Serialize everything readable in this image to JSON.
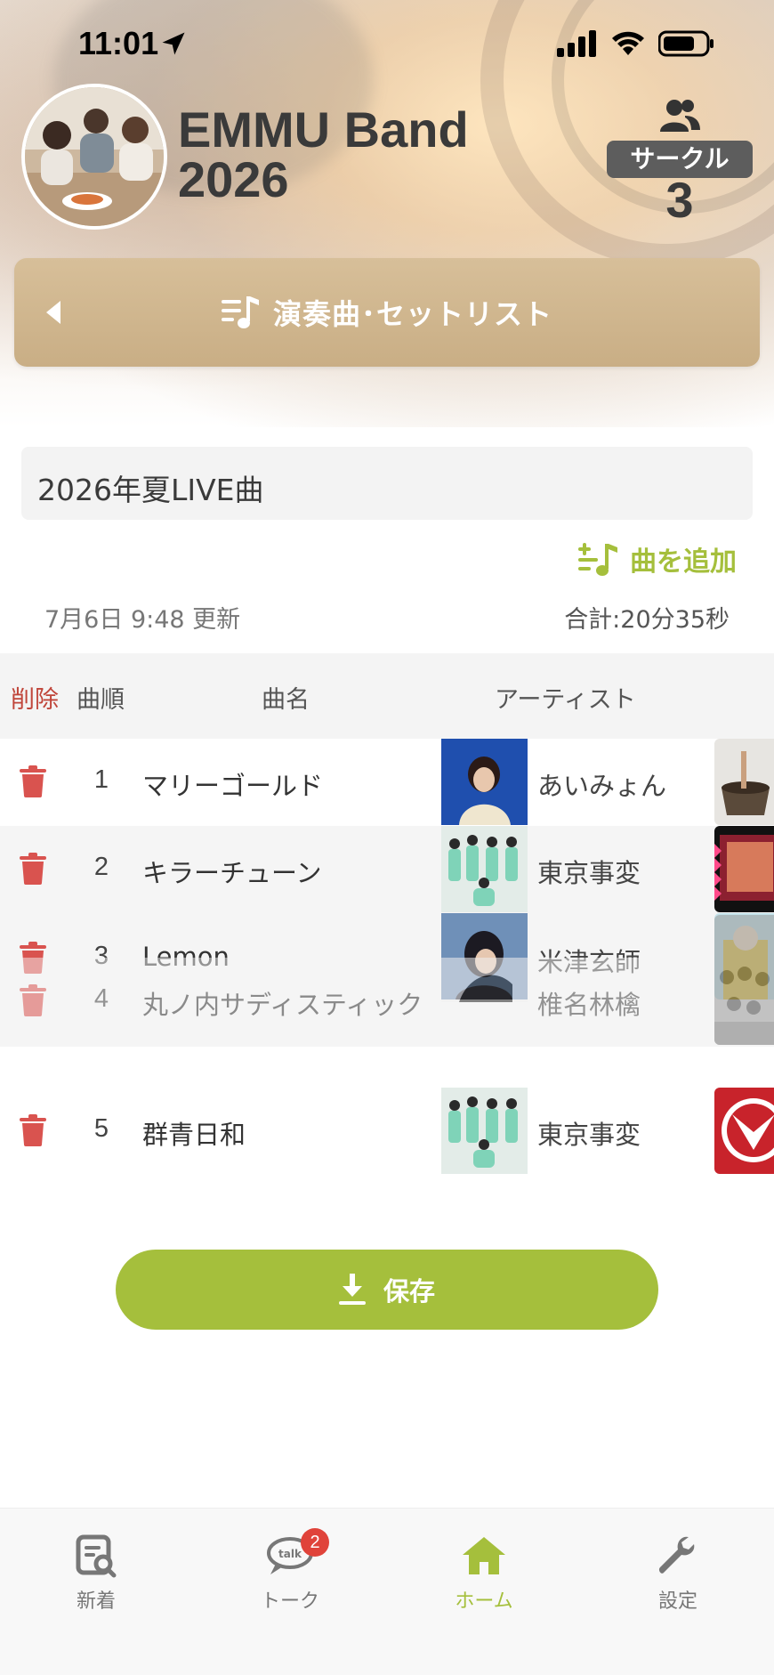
{
  "status_bar": {
    "time": "11:01"
  },
  "group": {
    "name_line1": "EMMU Band",
    "name_line2": "2026",
    "circle_label": "サークル",
    "circle_count": "3"
  },
  "section": {
    "title": "演奏曲･セットリスト"
  },
  "setlist": {
    "name": "2026年夏LIVE曲",
    "add_song_label": "曲を追加",
    "updated": "7月6日 9:48 更新",
    "total": "合計:20分35秒"
  },
  "table": {
    "headers": {
      "delete": "削除",
      "order": "曲順",
      "title": "曲名",
      "artist": "アーティスト"
    },
    "rows": [
      {
        "order": "1",
        "title": "マリーゴールド",
        "artist": "あいみょん"
      },
      {
        "order": "2",
        "title": "キラーチューン",
        "artist": "東京事変"
      },
      {
        "order": "3",
        "title": "Lemon",
        "artist": "米津玄師"
      },
      {
        "order": "4",
        "title": "丸ノ内サディスティック",
        "artist": "椎名林檎"
      },
      {
        "order": "5",
        "title": "群青日和",
        "artist": "東京事変"
      }
    ]
  },
  "actions": {
    "save_label": "保存"
  },
  "tabbar": {
    "items": [
      {
        "label": "新着",
        "icon": "news-search-icon"
      },
      {
        "label": "トーク",
        "icon": "talk-bubble-icon",
        "badge": "2"
      },
      {
        "label": "ホーム",
        "icon": "home-icon"
      },
      {
        "label": "設定",
        "icon": "wrench-icon"
      }
    ],
    "active": "ホーム"
  },
  "colors": {
    "accent": "#a5bf3c",
    "section_bar": "#d1b890",
    "delete_red": "#d9534f",
    "badge_red": "#e0433a"
  }
}
